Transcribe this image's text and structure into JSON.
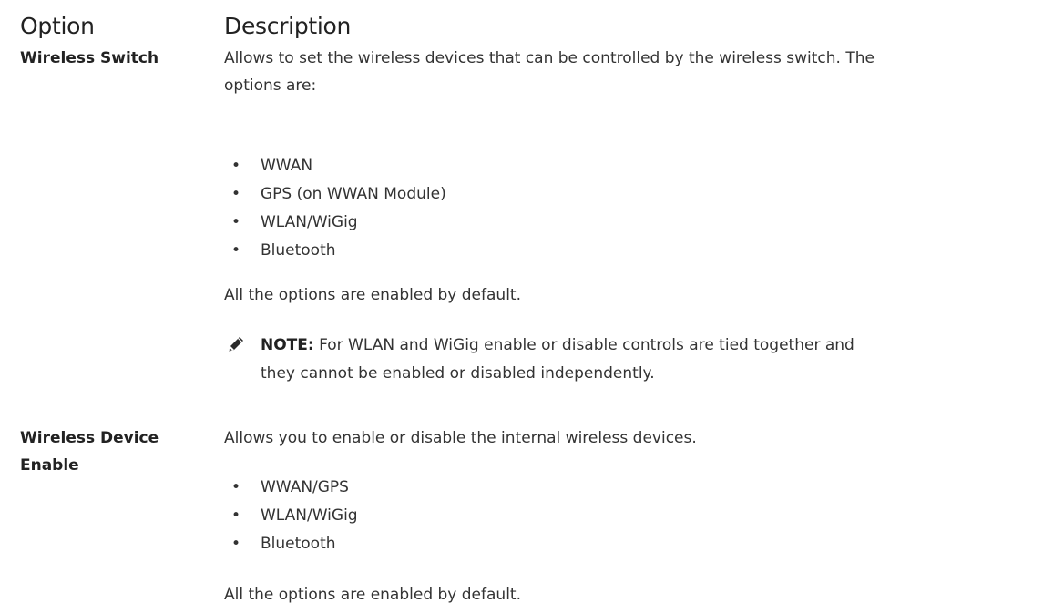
{
  "header": {
    "option": "Option",
    "description": "Description"
  },
  "rows": [
    {
      "option": "Wireless Switch",
      "description": "Allows to set the wireless devices that can be controlled by the wireless switch. The",
      "description_line2": "options are:",
      "items": [
        "WWAN",
        "GPS (on WWAN Module)",
        "WLAN/WiGig",
        "Bluetooth"
      ],
      "footer": "All the options are enabled by default.",
      "note": {
        "icon": "note-pencil-icon",
        "label": "NOTE:",
        "text_line1": " For WLAN and WiGig enable or disable controls are tied together and",
        "text_line2": "they cannot be enabled or disabled independently."
      }
    },
    {
      "option_line1": "Wireless Device",
      "option_line2": "Enable",
      "description": "Allows you to enable or disable the internal wireless devices.",
      "items": [
        "WWAN/GPS",
        "WLAN/WiGig",
        "Bluetooth"
      ],
      "footer": "All the options are enabled by default."
    }
  ],
  "bullet": "•"
}
